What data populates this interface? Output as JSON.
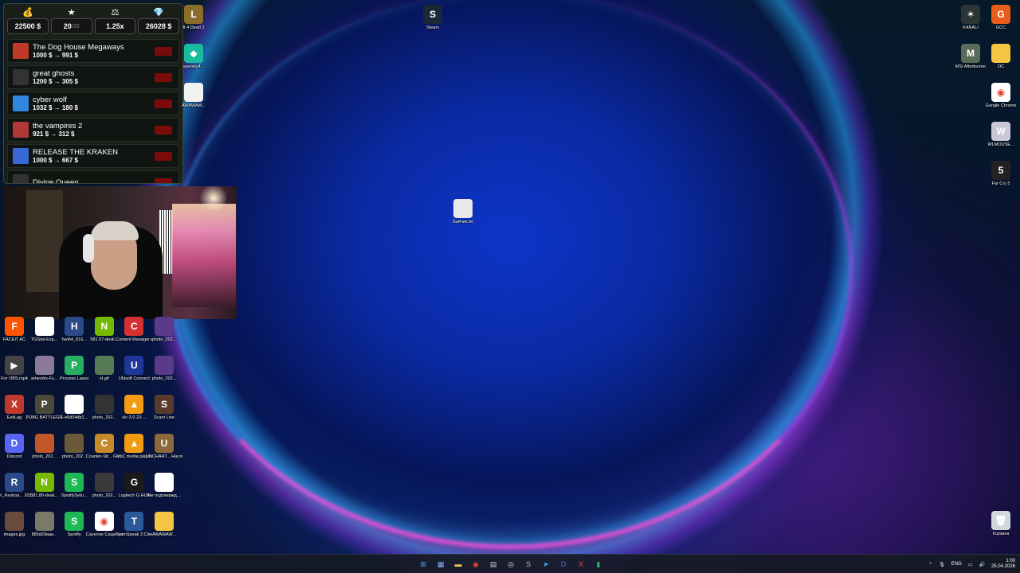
{
  "widget": {
    "stats": [
      {
        "icon": "money-bag-icon",
        "glyph": "💰",
        "value": "22500 $",
        "sub": ""
      },
      {
        "icon": "star-icon",
        "glyph": "★",
        "value": "20",
        "sub": "/20"
      },
      {
        "icon": "scales-icon",
        "glyph": "⚖",
        "value": "1.25x",
        "sub": ""
      },
      {
        "icon": "diamond-icon",
        "glyph": "💎",
        "value": "26028 $",
        "sub": ""
      }
    ],
    "games": [
      {
        "name": "The Dog House Megaways",
        "values": "1000 $ → 991 $",
        "thumb": "#c0392b"
      },
      {
        "name": "great ghosts",
        "values": "1200 $ → 305 $",
        "thumb": "#333333"
      },
      {
        "name": "cyber wolf",
        "values": "1032 $ → 180 $",
        "thumb": "#2e86de"
      },
      {
        "name": "the vampires 2",
        "values": "921 $ → 312 $",
        "thumb": "#b33939"
      },
      {
        "name": "RELEASE THE KRAKEN",
        "values": "1000 $ → 667 $",
        "thumb": "#3867d6"
      },
      {
        "name": "Divine Queen",
        "values": "",
        "thumb": "#333333"
      }
    ]
  },
  "desktop_icons": {
    "top": [
      {
        "label": "ft 4 Dead 2",
        "color": "#8a6d2a",
        "glyph": "L"
      },
      {
        "label": "spersky4...",
        "color": "#1abc9c",
        "glyph": "◆"
      },
      {
        "label": "AWAWAW...",
        "color": "#f1f1f1",
        "glyph": ""
      },
      {
        "label": "Steam",
        "color": "#1b2838",
        "glyph": "S"
      },
      {
        "label": "Байчик.txt",
        "color": "#e8e8e8",
        "glyph": ""
      }
    ],
    "right": [
      {
        "label": "KANALI",
        "color": "#2d3436",
        "glyph": "✶"
      },
      {
        "label": "GCC",
        "color": "#e85d1a",
        "glyph": "G"
      },
      {
        "label": "MSI Afterburner",
        "color": "#5a6b5a",
        "glyph": "M"
      },
      {
        "label": "ОС",
        "color": "#f4c542",
        "glyph": ""
      },
      {
        "label": "Google Chrome",
        "color": "#ffffff",
        "glyph": "◉"
      },
      {
        "label": "WLMOUSE...",
        "color": "#c8c8d8",
        "glyph": "W"
      },
      {
        "label": "Far Cry 5",
        "color": "#222222",
        "glyph": "5"
      },
      {
        "label": "Корзина",
        "color": "#cfd8dc",
        "glyph": "🗑"
      }
    ],
    "grid": [
      [
        {
          "label": "FACEIT AC",
          "color": "#ff5500",
          "glyph": "F"
        },
        {
          "label": "TGStat-Exp...",
          "color": "#ffffff",
          "glyph": ""
        },
        {
          "label": "hwi64_816...",
          "color": "#2b4a8a",
          "glyph": "H"
        },
        {
          "label": "581.57-desk...",
          "color": "#76b900",
          "glyph": "N"
        },
        {
          "label": "Content Manager.exe",
          "color": "#d63031",
          "glyph": "C"
        },
        {
          "label": "photo_202...",
          "color": "#5a3a8a",
          "glyph": ""
        }
      ],
      [
        {
          "label": "For OBS.mp4",
          "color": "#444444",
          "glyph": "▶"
        },
        {
          "label": "artworks-Fy...",
          "color": "#8a7a9a",
          "glyph": ""
        },
        {
          "label": "Process Lasso",
          "color": "#27ae60",
          "glyph": "P"
        },
        {
          "label": "xt.gif",
          "color": "#557a55",
          "glyph": ""
        },
        {
          "label": "Ubisoft Connect",
          "color": "#1e3799",
          "glyph": "U"
        },
        {
          "label": "photo_202...",
          "color": "#5a3a8a",
          "glyph": ""
        }
      ],
      [
        {
          "label": "ExitLag",
          "color": "#c0392b",
          "glyph": "X"
        },
        {
          "label": "PUBG BATTLEGR...",
          "color": "#4a4a3a",
          "glyph": "P"
        },
        {
          "label": "1-e6d04db1...",
          "color": "#ffffff",
          "glyph": ""
        },
        {
          "label": "photo_202...",
          "color": "#333333",
          "glyph": ""
        },
        {
          "label": "vlc-3.0.23-...",
          "color": "#f39c12",
          "glyph": "▲"
        },
        {
          "label": "Scam Line",
          "color": "#5a3a2a",
          "glyph": "S"
        }
      ],
      [
        {
          "label": "Discord",
          "color": "#5865f2",
          "glyph": "D"
        },
        {
          "label": "photo_202...",
          "color": "#c0562a",
          "glyph": ""
        },
        {
          "label": "photo_202...",
          "color": "#6a5a3a",
          "glyph": ""
        },
        {
          "label": "Counter-Str... Global Offe...",
          "color": "#c68a2a",
          "glyph": "C"
        },
        {
          "label": "VLC media player",
          "color": "#f39c12",
          "glyph": "▲"
        },
        {
          "label": "UNCHART... Наследие ...",
          "color": "#8a6a3a",
          "glyph": "U"
        }
      ],
      [
        {
          "label": "RK_Keyboa... 20250617.exe",
          "color": "#2a4a8a",
          "glyph": "R"
        },
        {
          "label": "581.80-desk...",
          "color": "#76b900",
          "glyph": "N"
        },
        {
          "label": "SpotifySetu...",
          "color": "#1db954",
          "glyph": "S"
        },
        {
          "label": "photo_202...",
          "color": "#3a3a3a",
          "glyph": ""
        },
        {
          "label": "Logitech G HUB",
          "color": "#1a1a1a",
          "glyph": "G"
        },
        {
          "label": "Не подтвержд...",
          "color": "#ffffff",
          "glyph": ""
        }
      ],
      [
        {
          "label": "images.jpg",
          "color": "#6a4a3a",
          "glyph": ""
        },
        {
          "label": "889a59aaa...",
          "color": "#7a7a6a",
          "glyph": ""
        },
        {
          "label": "Spotify",
          "color": "#1db954",
          "glyph": "S"
        },
        {
          "label": "Cayenne Coupé.pdf",
          "color": "#ffffff",
          "glyph": "◉"
        },
        {
          "label": "TeamSpeak 3 Client",
          "color": "#2a5a9a",
          "glyph": "T"
        },
        {
          "label": "AWAWAW...",
          "color": "#f4c542",
          "glyph": ""
        }
      ]
    ]
  },
  "taskbar": {
    "apps": [
      {
        "name": "start-icon",
        "glyph": "⊞",
        "color": "#4aa3ff"
      },
      {
        "name": "task-view-icon",
        "glyph": "▦",
        "color": "#8ab4f8"
      },
      {
        "name": "file-explorer-icon",
        "glyph": "▬",
        "color": "#f4c542"
      },
      {
        "name": "chrome-icon",
        "glyph": "◉",
        "color": "#e94235"
      },
      {
        "name": "calculator-icon",
        "glyph": "▤",
        "color": "#cccccc"
      },
      {
        "name": "obs-icon",
        "glyph": "◎",
        "color": "#dddddd"
      },
      {
        "name": "steam-icon",
        "glyph": "S",
        "color": "#bbbbbb"
      },
      {
        "name": "telegram-icon",
        "glyph": "➤",
        "color": "#2aabee"
      },
      {
        "name": "discord-icon",
        "glyph": "D",
        "color": "#5865f2"
      },
      {
        "name": "app-x-icon",
        "glyph": "X",
        "color": "#e74c3c"
      },
      {
        "name": "process-lasso-icon",
        "glyph": "▮",
        "color": "#27ae60"
      }
    ],
    "language": "ENG",
    "time": "1:00",
    "date": "25.04.2026"
  }
}
